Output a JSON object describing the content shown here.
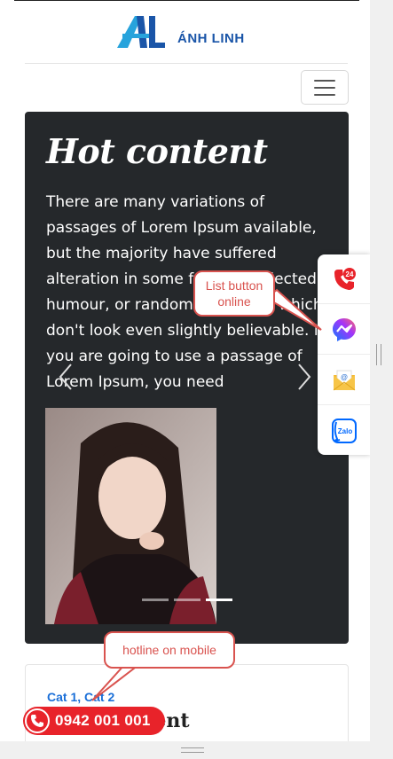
{
  "header": {
    "logo_text": "ÁNH LINH"
  },
  "hero": {
    "title": "Hot content",
    "text": "There are many variations of passages of Lorem Ipsum available, but the majority have suffered alteration in some form, by injected humour, or randomised words which don't look even slightly believable. If you are going to use a passage of Lorem Ipsum, you need",
    "indicator_count": 3,
    "active_indicator": 3
  },
  "card": {
    "category": "Cat 1, Cat 2",
    "title": "Content"
  },
  "hotline": {
    "number": "0942 001 001"
  },
  "float_buttons": [
    {
      "icon": "phone-24-icon"
    },
    {
      "icon": "messenger-icon"
    },
    {
      "icon": "email-icon"
    },
    {
      "icon": "zalo-icon",
      "label": "Zalo"
    }
  ],
  "annotations": {
    "list_button": "List button online",
    "hotline_mobile": "hotline on mobile"
  },
  "colors": {
    "brand_blue": "#1a55a8",
    "hero_bg": "#25282b",
    "hotline_red": "#e8232a",
    "callout_red": "#d9534f"
  }
}
